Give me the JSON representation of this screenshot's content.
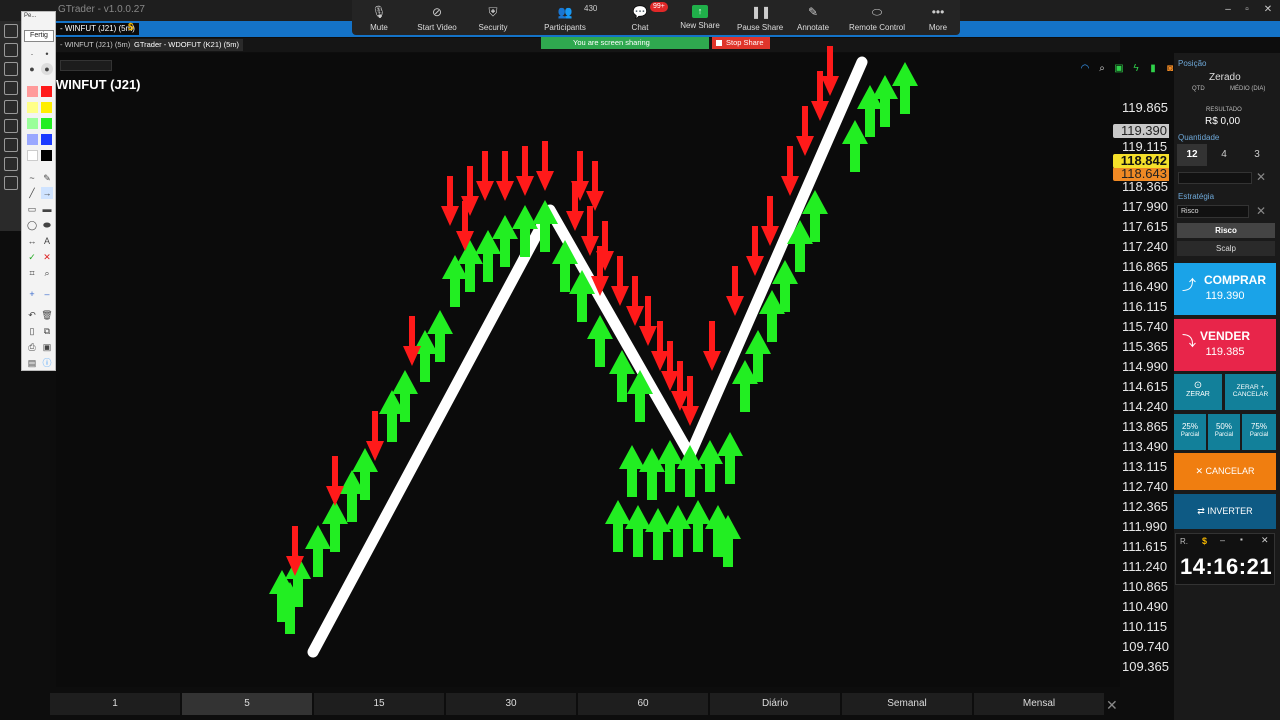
{
  "app": {
    "title": "GTrader - v1.0.0.27"
  },
  "tabs": [
    {
      "label": "- WINFUT (J21) (5m)"
    },
    {
      "label": "$"
    }
  ],
  "subtabs": [
    {
      "label": "- WINFUT (J21) (5m)"
    },
    {
      "label": "GTrader - WDOFUT (K21) (5m)"
    }
  ],
  "meeting_toolbar": {
    "items": [
      {
        "label": "Mute",
        "icon": "microphone-icon"
      },
      {
        "label": "Start Video",
        "icon": "video-off-icon"
      },
      {
        "label": "Security",
        "icon": "shield-icon"
      },
      {
        "label": "Participants",
        "icon": "participants-icon",
        "count": "430"
      },
      {
        "label": "Chat",
        "icon": "chat-icon",
        "badge": "99+"
      },
      {
        "label": "New Share",
        "icon": "share-icon"
      },
      {
        "label": "Pause Share",
        "icon": "pause-icon"
      },
      {
        "label": "Annotate",
        "icon": "pencil-icon"
      },
      {
        "label": "Remote Control",
        "icon": "mouse-icon"
      },
      {
        "label": "More",
        "icon": "more-icon"
      }
    ],
    "sharing_status": "You are screen sharing",
    "stop_share": "Stop Share"
  },
  "palette": {
    "title": "Pe...",
    "font_label": "Fertig"
  },
  "chart": {
    "title": "WINFUT (J21)",
    "price_labels": [
      "119.865",
      "119.115",
      "118.365",
      "117.990",
      "117.615",
      "117.240",
      "116.865",
      "116.490",
      "116.115",
      "115.740",
      "115.365",
      "114.990",
      "114.615",
      "114.240",
      "113.865",
      "113.490",
      "113.115",
      "112.740",
      "112.365",
      "111.990",
      "111.615",
      "111.240",
      "110.865",
      "110.490",
      "110.115",
      "109.740",
      "109.365"
    ],
    "last_price_tag": "119.390",
    "current_price_tag": "118.842",
    "orange_tag": "118.643"
  },
  "timeframes": [
    "1",
    "5",
    "15",
    "30",
    "60",
    "Diário",
    "Semanal",
    "Mensal"
  ],
  "active_timeframe": "5",
  "panel": {
    "position_label": "Posição",
    "position_status": "Zerado",
    "qtd_label": "QTD",
    "medio_label": "MÉDIO (DIA)",
    "resultado_label": "RESULTADO",
    "resultado_value": "R$  0,00",
    "quantity_label": "Quantidade",
    "quantities": [
      "12",
      "4",
      "3"
    ],
    "strategy_label": "Estratégia",
    "strategy_value": "Risco",
    "strategy_options": [
      "Risco",
      "Scalp"
    ],
    "buy_label": "COMPRAR",
    "buy_price": "119.390",
    "sell_label": "VENDER",
    "sell_price": "119.385",
    "zerar_label": "ZERAR",
    "zerar_cancelar_label": "ZERAR + CANCELAR",
    "partials": [
      {
        "pct": "25%",
        "label": "Parcial"
      },
      {
        "pct": "50%",
        "label": "Parcial"
      },
      {
        "pct": "75%",
        "label": "Parcial"
      }
    ],
    "cancel_label": "CANCELAR",
    "invert_label": "INVERTER",
    "clock_prefix": "R.",
    "clock": "14:16:21"
  },
  "colors": {
    "buy": "#1aa3e8",
    "sell": "#e8254a",
    "cancel": "#f07e10",
    "invert": "#0e5a84",
    "zerar": "#12809a",
    "annotation_green": "#22ee22",
    "annotation_red": "#ff1a1a",
    "price_highlight": "#f5e02a"
  }
}
